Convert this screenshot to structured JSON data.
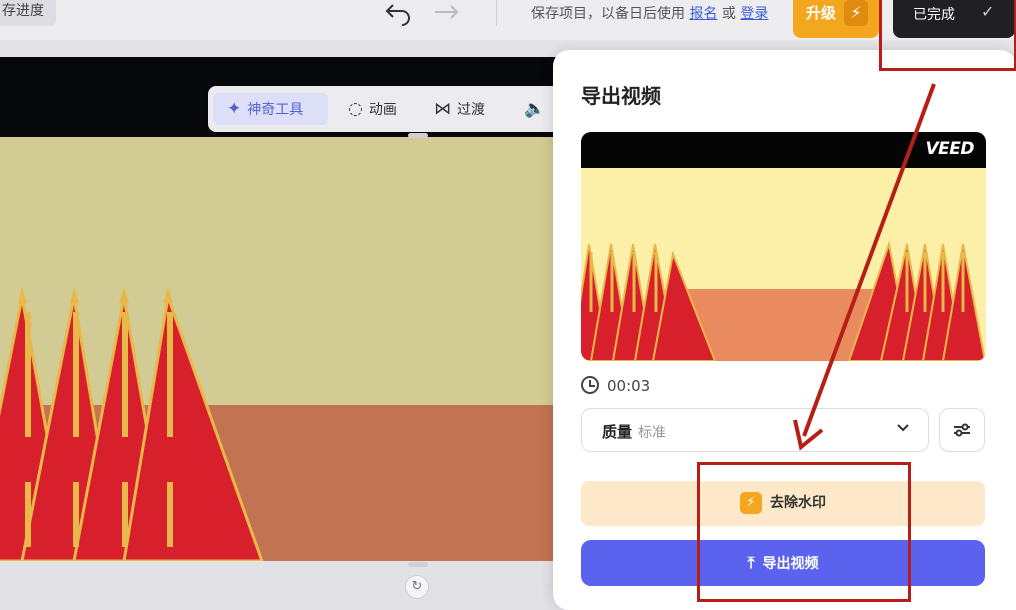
{
  "header": {
    "save_progress": "存进度",
    "undo_icon": "undo-arrow-icon",
    "redo_icon": "redo-arrow-icon",
    "save_note_prefix": "保存项目，以备日后使用",
    "signup_link": "报名",
    "or": "或",
    "login_link": "登录",
    "upgrade_label": "升级",
    "upgrade_icon": "⚡",
    "done_label": "已完成",
    "done_icon": "✓"
  },
  "canvas_toolbar": {
    "magic_tools": "神奇工具",
    "magic_icon": "✦",
    "animation": "动画",
    "animation_icon": "◌",
    "transition": "过渡",
    "transition_icon": "⋈",
    "audio_icon": "🔈"
  },
  "export_panel": {
    "title": "导出视频",
    "preview_logo": "VEED",
    "duration": "00:03",
    "quality_label": "质量",
    "quality_value": "标准",
    "chevron_icon": "⌄",
    "settings_icon": "⚙",
    "remove_watermark": "去除水印",
    "watermark_icon": "⚡",
    "export_label": "导出视频",
    "export_icon": "⤒"
  },
  "colors": {
    "accent": "#5b63ee",
    "upgrade": "#f2a71f",
    "done_bg": "#1f1f24",
    "annotation": "#b71f16",
    "flag_red": "#d8202d",
    "gold": "#e8b84a"
  }
}
